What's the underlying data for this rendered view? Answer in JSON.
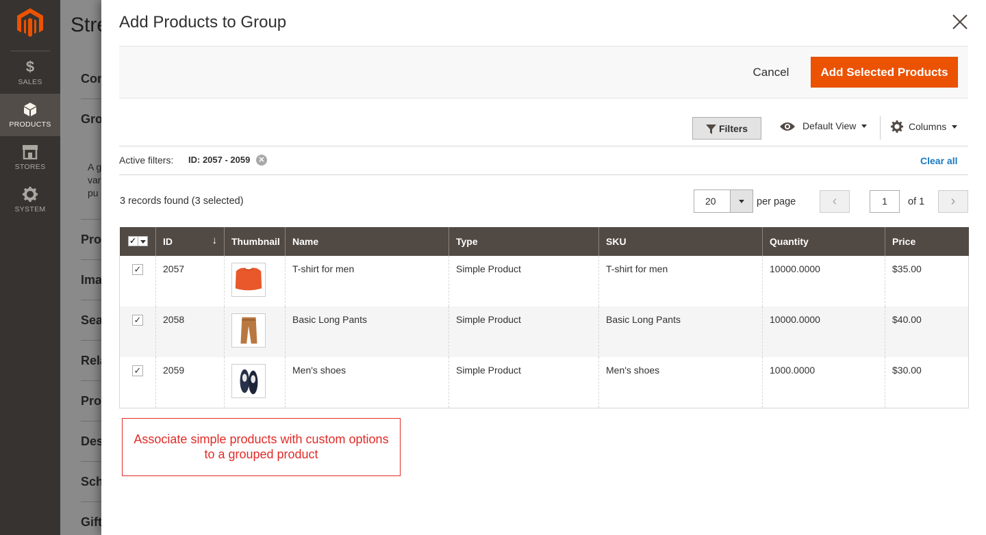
{
  "sidebar": {
    "items": [
      {
        "label": "SALES",
        "icon": "dollar-icon",
        "glyph": "$"
      },
      {
        "label": "PRODUCTS",
        "icon": "cube-icon",
        "active": true
      },
      {
        "label": "STORES",
        "icon": "store-icon"
      },
      {
        "label": "SYSTEM",
        "icon": "gear-icon"
      }
    ],
    "colors": {
      "background": "#373330",
      "active": "#524d49",
      "logo": "#eb5202"
    }
  },
  "background_page": {
    "title": "Stre",
    "sections": [
      "Con",
      "Gro",
      "Pro",
      "Ima",
      "Sea",
      "Rela",
      "Pro",
      "Des",
      "Sch",
      "Gift"
    ],
    "text_lines": [
      "A g",
      "var",
      "pu"
    ]
  },
  "modal": {
    "title": "Add Products to Group",
    "cancel_label": "Cancel",
    "add_label": "Add Selected Products",
    "accent_color": "#eb5202"
  },
  "toolbar": {
    "filters_label": "Filters",
    "view_label": "Default View",
    "columns_label": "Columns"
  },
  "active_filters": {
    "label": "Active filters:",
    "chip": "ID: 2057 - 2059",
    "clear_all": "Clear all"
  },
  "records": {
    "summary": "3 records found (3 selected)",
    "per_page_value": "20",
    "per_page_label": "per page",
    "page": "1",
    "of_label": "of 1"
  },
  "grid": {
    "columns": [
      "ID",
      "Thumbnail",
      "Name",
      "Type",
      "SKU",
      "Quantity",
      "Price"
    ],
    "rows": [
      {
        "id": "2057",
        "name": "T-shirt for men",
        "type": "Simple Product",
        "sku": "T-shirt for men",
        "quantity": "10000.0000",
        "price": "$35.00",
        "checked": true,
        "thumb": "tshirt"
      },
      {
        "id": "2058",
        "name": "Basic Long Pants",
        "type": "Simple Product",
        "sku": "Basic Long Pants",
        "quantity": "10000.0000",
        "price": "$40.00",
        "checked": true,
        "thumb": "pants"
      },
      {
        "id": "2059",
        "name": "Men's shoes",
        "type": "Simple Product",
        "sku": "Men's shoes",
        "quantity": "1000.0000",
        "price": "$30.00",
        "checked": true,
        "thumb": "shoes"
      }
    ],
    "header_color": "#514943"
  },
  "annotation": {
    "line1": "Associate simple products with custom options",
    "line2": "to a grouped product",
    "color": "#e02b27"
  }
}
